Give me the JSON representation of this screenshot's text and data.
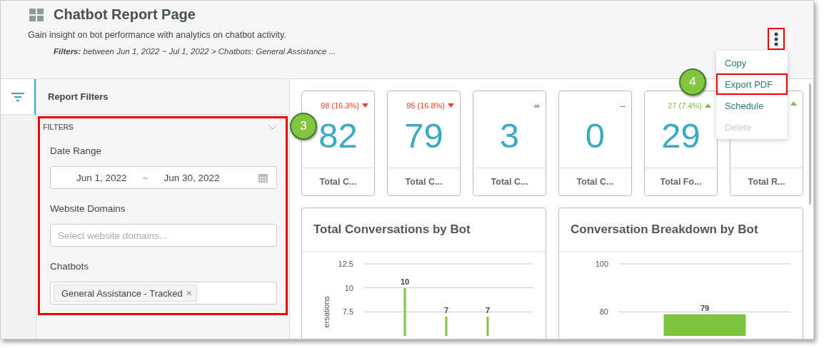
{
  "header": {
    "title": "Chatbot Report Page",
    "description": "Gain insight on bot performance with analytics on chatbot activity.",
    "filters_summary": "**Filters:** between Jun 1, 2022 ~ Jul 1, 2022 > Chatbots: General Assistance ...",
    "menu_highlighted": true
  },
  "menu": [
    {
      "label": "Copy",
      "disabled": false,
      "highlighted": false
    },
    {
      "label": "Export PDF",
      "disabled": false,
      "highlighted": true
    },
    {
      "label": "Schedule",
      "disabled": false,
      "highlighted": false
    },
    {
      "label": "Delete",
      "disabled": true,
      "highlighted": false
    }
  ],
  "sidebar": {
    "title": "Report Filters",
    "section": "FILTERS",
    "highlighted": true,
    "date_range": {
      "label": "Date Range",
      "from": "Jun 1, 2022",
      "separator": "~",
      "to": "Jun 30, 2022"
    },
    "domains": {
      "label": "Website Domains",
      "placeholder": "Select website domains..."
    },
    "chatbots": {
      "label": "Chatbots",
      "tags": [
        "General Assistance - Tracked"
      ],
      "remove": "×"
    }
  },
  "kpis": [
    {
      "delta": "98 (16.3%)",
      "kind": "down",
      "value": "82",
      "label": "Total C..."
    },
    {
      "delta": "95 (16.8%)",
      "kind": "down",
      "value": "79",
      "label": "Total C..."
    },
    {
      "delta": "∞",
      "kind": "flat",
      "value": "3",
      "label": "Total C..."
    },
    {
      "delta": "--",
      "kind": "flat",
      "value": "0",
      "label": "Total C..."
    },
    {
      "delta": "27 (7.4%)",
      "kind": "up",
      "value": "29",
      "label": "Total Fo..."
    },
    {
      "kind": "up",
      "label": "Total R..."
    }
  ],
  "charts": [
    {
      "title": "Total Conversations by Bot",
      "chart_data": {
        "type": "bar",
        "ylabel": "ersations",
        "ylim": [
          5,
          12.5
        ],
        "yticks": [
          7.5,
          10,
          12.5
        ],
        "values": [
          10,
          7,
          7
        ],
        "value_labels": [
          "10",
          "7",
          "7"
        ]
      }
    },
    {
      "title": "Conversation Breakdown by Bot",
      "chart_data": {
        "type": "bar",
        "ylim": [
          70,
          100
        ],
        "yticks": [
          80,
          100
        ],
        "values": [
          79
        ],
        "value_labels": [
          "79"
        ]
      }
    }
  ],
  "callouts": [
    {
      "label": "3"
    },
    {
      "label": "4"
    }
  ]
}
